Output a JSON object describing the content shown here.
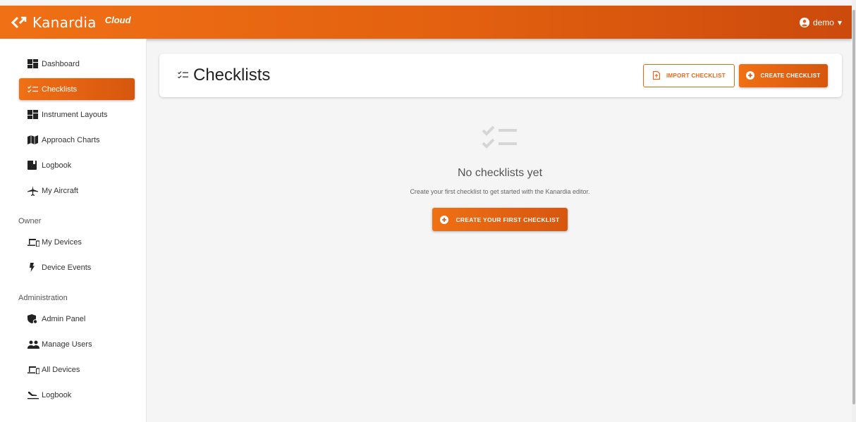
{
  "header": {
    "brand_name": "Kanardia",
    "brand_suffix": "Cloud",
    "user_label": "demo",
    "caret": "▾"
  },
  "sidebar": {
    "main_items": [
      {
        "label": "Dashboard",
        "icon": "dashboard-icon"
      },
      {
        "label": "Checklists",
        "icon": "checklist-icon",
        "active": true
      },
      {
        "label": "Instrument Layouts",
        "icon": "dashboard-icon"
      },
      {
        "label": "Approach Charts",
        "icon": "map-icon"
      },
      {
        "label": "Logbook",
        "icon": "book-icon"
      },
      {
        "label": "My Aircraft",
        "icon": "airplane-icon"
      }
    ],
    "owner_title": "Owner",
    "owner_items": [
      {
        "label": "My Devices",
        "icon": "devices-icon"
      },
      {
        "label": "Device Events",
        "icon": "bolt-icon"
      }
    ],
    "admin_title": "Administration",
    "admin_items": [
      {
        "label": "Admin Panel",
        "icon": "admin-shield-icon"
      },
      {
        "label": "Manage Users",
        "icon": "users-icon"
      },
      {
        "label": "All Devices",
        "icon": "devices-icon"
      },
      {
        "label": "Logbook",
        "icon": "flight-land-icon"
      }
    ]
  },
  "page": {
    "title": "Checklists",
    "import_label": "IMPORT CHECKLIST",
    "create_label": "CREATE CHECKLIST"
  },
  "empty_state": {
    "title": "No checklists yet",
    "subtitle": "Create your first checklist to get started with the Kanardia editor.",
    "button_label": "CREATE YOUR FIRST CHECKLIST"
  },
  "colors": {
    "accent": "#e8661a",
    "accent_dark": "#cc4a0c",
    "background": "#f5f5f5"
  }
}
